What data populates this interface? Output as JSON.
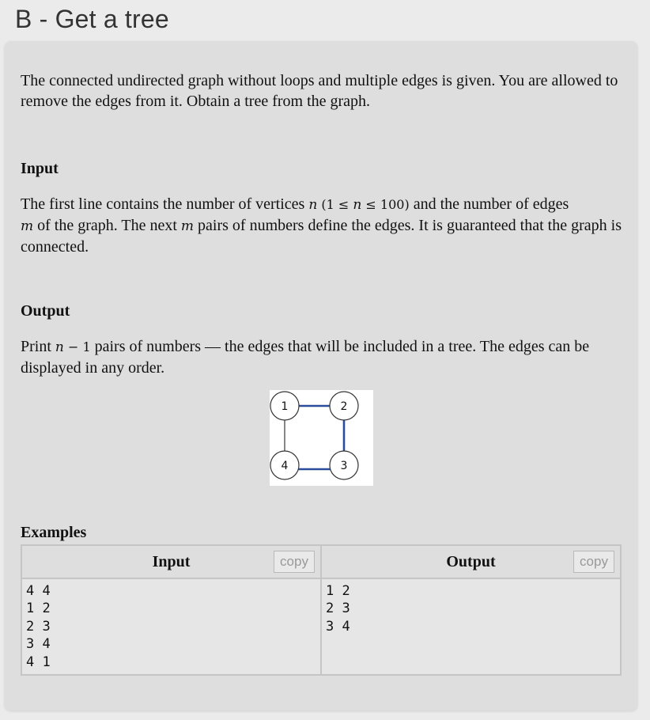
{
  "title": "B - Get a tree",
  "statement": "The connected undirected graph without loops and multiple edges is given. You are allowed to remove the edges from it. Obtain a tree from the graph.",
  "input_heading": "Input",
  "input_text": {
    "part1": "The first line contains the number of vertices ",
    "var_n": "n",
    "constraint_open": " (1 ≤ ",
    "constraint_n": "n",
    "constraint_close": " ≤ 100)",
    "part2": " and the number of edges",
    "var_m1": "m",
    "part3": " of the graph. The next ",
    "var_m2": "m",
    "part4": " pairs of numbers define the edges. It is guaranteed that the graph is connected."
  },
  "output_heading": "Output",
  "output_text": {
    "part1": "Print ",
    "var_n": "n",
    "minus_one": " − 1",
    "part2": " pairs of numbers — the edges that will be included in a tree. The edges can be displayed in any order."
  },
  "graph": {
    "nodes": [
      "1",
      "2",
      "3",
      "4"
    ],
    "tree_edge_color": "#2a4d9b",
    "removed_edge_color": "#333333"
  },
  "examples": {
    "heading": "Examples",
    "input_header": "Input",
    "output_header": "Output",
    "copy_label": "copy",
    "input_data": "4 4\n1 2\n2 3\n3 4\n4 1",
    "output_data": "1 2\n2 3\n3 4"
  }
}
